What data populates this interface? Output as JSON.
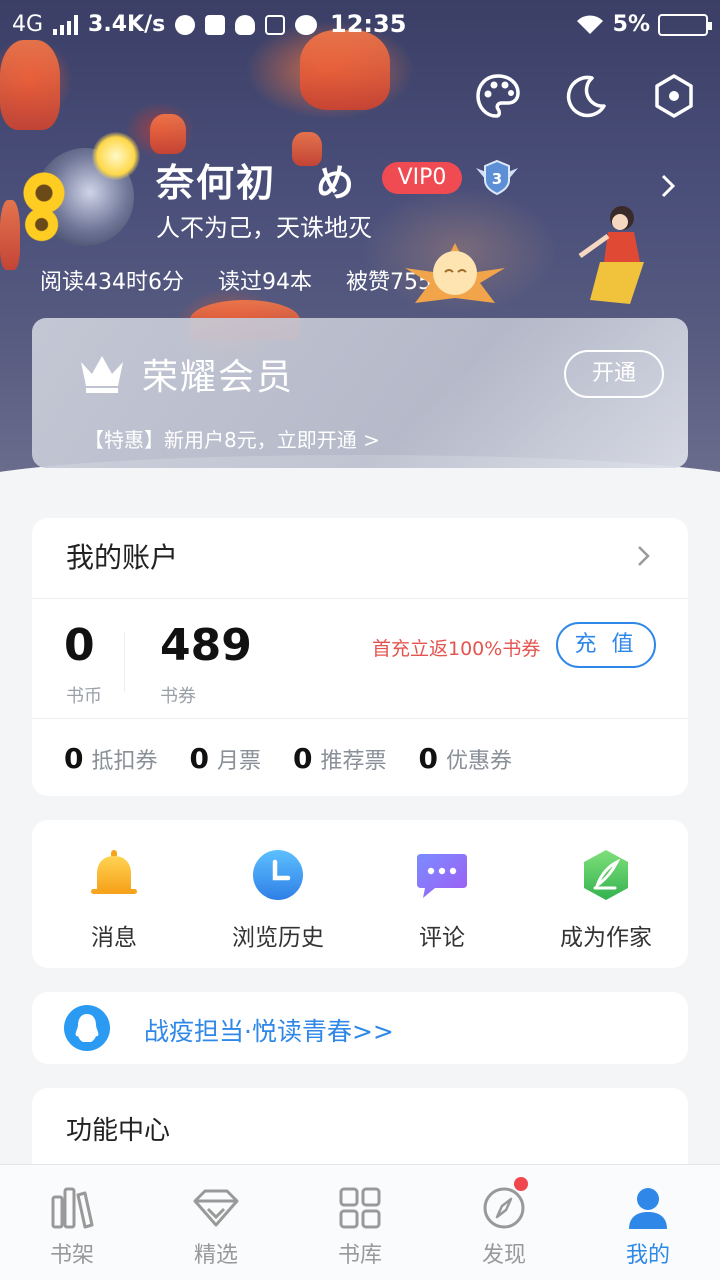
{
  "status_bar": {
    "network": "4G",
    "speed": "3.4K/s",
    "time": "12:35",
    "battery": "5%"
  },
  "profile": {
    "name": "奈何初　め",
    "vip_level": "VIP0",
    "level_badge": "3",
    "motto": "人不为己，天诛地灭",
    "stats": {
      "reading_time": "阅读434时6分",
      "books_read": "读过94本",
      "likes": "被赞755次"
    }
  },
  "vip_card": {
    "title": "荣耀会员",
    "promo": "【特惠】新用户8元，立即开通 >",
    "button": "开通"
  },
  "account": {
    "title": "我的账户",
    "coins": {
      "value": "0",
      "label": "书币"
    },
    "vouchers": {
      "value": "489",
      "label": "书券"
    },
    "promo": "首充立返100%书券",
    "recharge_button": "充 值",
    "tickets": [
      {
        "value": "0",
        "label": "抵扣券"
      },
      {
        "value": "0",
        "label": "月票"
      },
      {
        "value": "0",
        "label": "推荐票"
      },
      {
        "value": "0",
        "label": "优惠券"
      }
    ]
  },
  "shortcuts": [
    {
      "label": "消息",
      "icon": "bell-icon"
    },
    {
      "label": "浏览历史",
      "icon": "clock-icon"
    },
    {
      "label": "评论",
      "icon": "comment-icon"
    },
    {
      "label": "成为作家",
      "icon": "pen-icon"
    }
  ],
  "banner": {
    "text": "战疫担当·悦读青春>>",
    "icon": "qq-icon"
  },
  "function_center": {
    "title": "功能中心"
  },
  "bottom_nav": [
    {
      "label": "书架",
      "icon": "bookshelf-icon",
      "active": false
    },
    {
      "label": "精选",
      "icon": "diamond-icon",
      "active": false
    },
    {
      "label": "书库",
      "icon": "grid-icon",
      "active": false
    },
    {
      "label": "发现",
      "icon": "compass-icon",
      "active": false,
      "badge": true
    },
    {
      "label": "我的",
      "icon": "person-icon",
      "active": true
    }
  ],
  "colors": {
    "accent": "#2f88e8",
    "vip_badge": "#f04a52",
    "promo_red": "#e5554f"
  }
}
